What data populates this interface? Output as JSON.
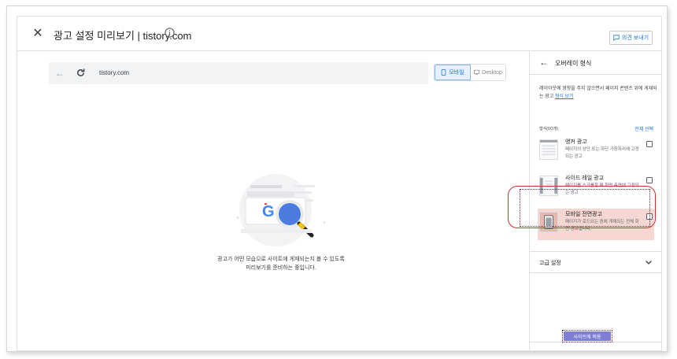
{
  "header": {
    "title": "광고 설정 미리보기 | tistory.com",
    "feedback_label": "의견 보내기"
  },
  "browser": {
    "url": "tistory.com",
    "device_mobile": "모바일",
    "device_desktop": "Desktop",
    "selected_device": "모바일"
  },
  "preview": {
    "loading_text": "광고가 어떤 모습으로 사이트에 게재되는지 볼 수 있도록 미리보기를 준비하는 중입니다."
  },
  "panel": {
    "title": "오버레이 형식",
    "description": "레이아웃에 영향을 주지 않으면서 페이지 콘텐츠 위에 게재되는 광고",
    "description_link": "형식 보기",
    "format_count": "형식(0/3개)",
    "select_all": "전체 선택",
    "formats": [
      {
        "title": "앵커 광고",
        "desc": "페이지의 상단 또는 하단 가장자리에 고정되는 광고",
        "checked": false
      },
      {
        "title": "사이드 레일 광고",
        "desc": "페이지를 스크롤할 때 화면 측면에 고정되는 광고",
        "checked": false
      },
      {
        "title": "모바일 전면광고",
        "desc": "페이지가 로드되는 중에 게재되는 전체 화면 광고입니다.",
        "checked": false
      }
    ],
    "advanced_label": "고급 설정",
    "apply_label": "사이트에 적용"
  },
  "colors": {
    "accent": "#1a73e8",
    "highlight_ring": "#d32f2f",
    "apply_button": "#7e7ed6"
  }
}
